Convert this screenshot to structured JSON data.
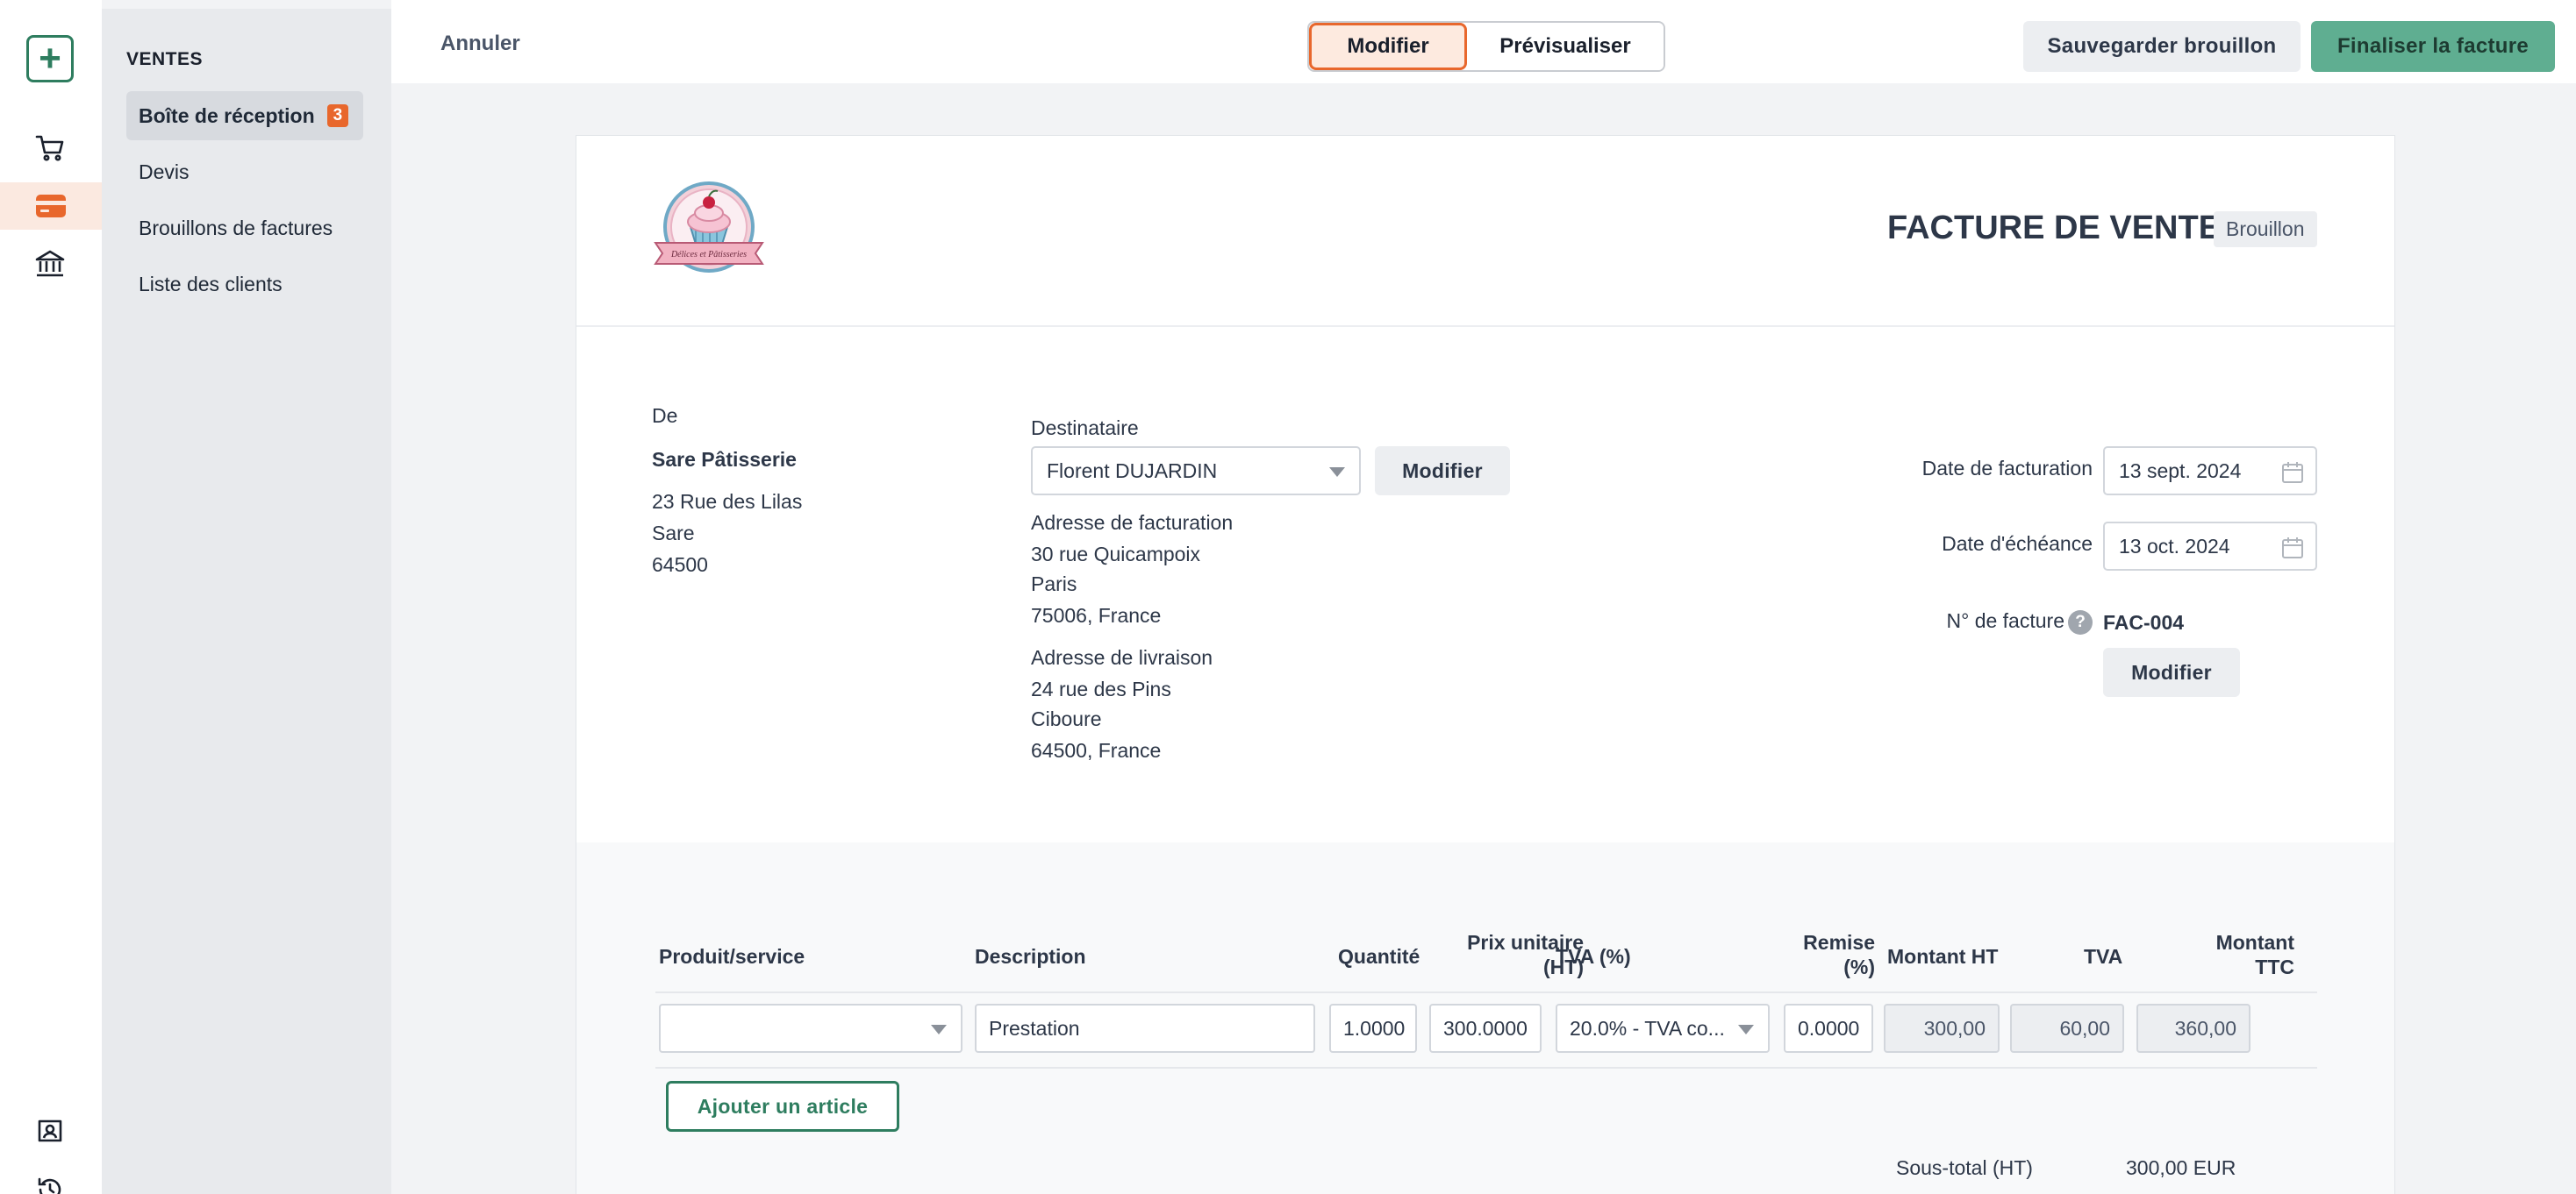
{
  "rail": {
    "icons": [
      "plus-icon",
      "cart-icon",
      "card-icon",
      "bank-icon",
      "contacts-icon",
      "history-icon"
    ],
    "accent": "#e8672c",
    "brand": "#2e7d5f"
  },
  "sidebar": {
    "title": "VENTES",
    "items": [
      {
        "label": "Boîte de réception",
        "badge": "3"
      },
      {
        "label": "Devis"
      },
      {
        "label": "Brouillons de factures"
      },
      {
        "label": "Liste des clients"
      }
    ]
  },
  "topbar": {
    "cancel": "Annuler",
    "tab_edit": "Modifier",
    "tab_preview": "Prévisualiser",
    "save_draft": "Sauvegarder brouillon",
    "finalize": "Finaliser la facture"
  },
  "invoice": {
    "logo_text": "Délices et Pâtisseries",
    "title": "FACTURE DE VENTE",
    "status": "Brouillon",
    "from": {
      "label": "De",
      "name": "Sare Pâtisserie",
      "street": "23 Rue des Lilas",
      "city": "Sare",
      "zip": "64500"
    },
    "recipient": {
      "label": "Destinataire",
      "value": "Florent DUJARDIN",
      "edit": "Modifier",
      "billing_label": "Adresse de facturation",
      "billing_street": "30 rue Quicampoix",
      "billing_city": "Paris",
      "billing_zip": "75006, France",
      "shipping_label": "Adresse de livraison",
      "shipping_street": "24 rue des Pins",
      "shipping_city": "Ciboure",
      "shipping_zip": "64500, France"
    },
    "invoice_date_label": "Date de facturation",
    "invoice_date": "13 sept. 2024",
    "due_date_label": "Date d'échéance",
    "due_date": "13 oct. 2024",
    "number_label": "N° de facture",
    "help": "?",
    "number": "FAC-004",
    "number_edit": "Modifier"
  },
  "table": {
    "headers": {
      "product": "Produit/service",
      "description": "Description",
      "qty": "Quantité",
      "unit_price_1": "Prix unitaire",
      "unit_price_2": "(HT)",
      "vat_rate": "TVA (%)",
      "discount_1": "Remise",
      "discount_2": "(%)",
      "amount_ht": "Montant HT",
      "vat": "TVA",
      "amount_ttc_1": "Montant",
      "amount_ttc_2": "TTC"
    },
    "rows": [
      {
        "product": "",
        "description": "Prestation",
        "qty": "1.0000",
        "unit_price": "300.0000",
        "vat_rate": "20.0% - TVA co...",
        "discount": "0.0000",
        "amount_ht": "300,00",
        "vat": "60,00",
        "amount_ttc": "360,00"
      }
    ],
    "add_item": "Ajouter un article",
    "subtotal_label": "Sous-total (HT)",
    "subtotal_value": "300,00 EUR"
  }
}
